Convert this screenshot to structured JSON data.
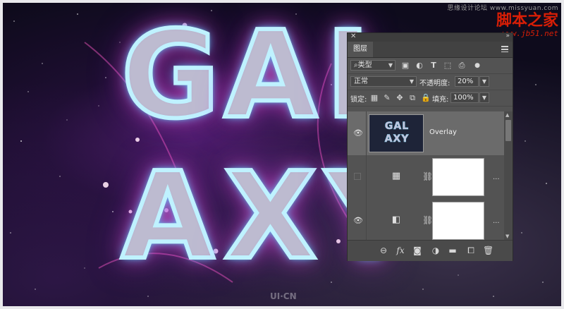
{
  "watermark": {
    "top_text": "思缘设计论坛 www.missyuan.com",
    "brand": "脚本之家",
    "url": "www.jb51.net",
    "corner_logo": "UI·CN"
  },
  "artwork": {
    "row1": [
      "G",
      "A",
      "L"
    ],
    "row2": [
      "A",
      "X",
      "Y"
    ]
  },
  "panel": {
    "tab_label": "图层",
    "filter": {
      "kind_label": "类型",
      "icons": [
        "image-filter-icon",
        "adjustment-filter-icon",
        "type-filter-icon",
        "shape-filter-icon",
        "smart-object-filter-icon"
      ]
    },
    "blend_mode": "正常",
    "opacity_label": "不透明度:",
    "opacity_value": "20%",
    "lock_label": "锁定:",
    "fill_label": "填充:",
    "fill_value": "100%",
    "layers": [
      {
        "name": "Overlay",
        "visible": true,
        "selected": true,
        "thumb_line1": "GAL",
        "thumb_line2": "AXY"
      },
      {
        "name": "",
        "visible": false,
        "selected": false,
        "adjustment_icon": "grid-adjustment-icon"
      },
      {
        "name": "",
        "visible": true,
        "selected": false,
        "adjustment_icon": "gradient-map-icon"
      }
    ],
    "bottom_icons": [
      "link-layers-icon",
      "fx-icon",
      "add-mask-icon",
      "new-adjustment-icon",
      "new-group-icon",
      "new-layer-icon",
      "delete-layer-icon"
    ],
    "fx_text": "fx",
    "ellipsis": "..."
  }
}
